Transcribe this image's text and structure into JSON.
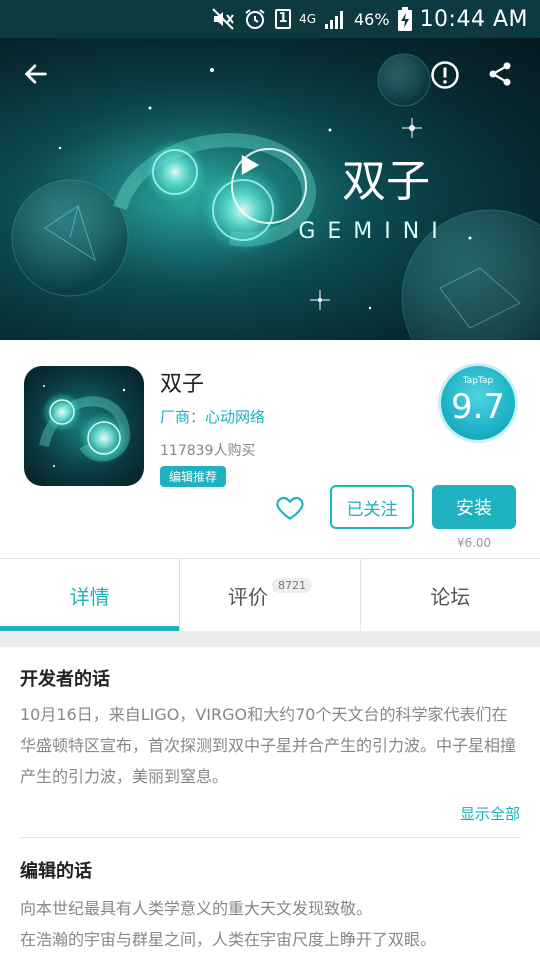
{
  "status_bar": {
    "sim_slot": "1",
    "network": "4G",
    "battery_percent": "46%",
    "time": "10:44 AM",
    "icons": [
      "mute-icon",
      "alarm-icon",
      "sim-icon",
      "signal-icon",
      "battery-charging-icon"
    ]
  },
  "hero": {
    "title_cn": "双子",
    "title_en": "GEMINI",
    "icons": [
      "back-arrow-icon",
      "report-icon",
      "share-icon",
      "play-icon"
    ]
  },
  "app": {
    "name": "双子",
    "developer": "厂商：心动网络",
    "purchases": "117839人购买",
    "badge": "编辑推荐",
    "rating_brand": "TapTap",
    "rating": "9.7",
    "follow_label": "已关注",
    "install_label": "安装",
    "price": "¥6.00"
  },
  "tabs": [
    {
      "label": "详情",
      "active": true
    },
    {
      "label": "评价",
      "count": "8721",
      "active": false
    },
    {
      "label": "论坛",
      "active": false
    }
  ],
  "developer_note": {
    "title": "开发者的话",
    "body": "10月16日，来自LIGO，VIRGO和大约70个天文台的科学家代表们在华盛顿特区宣布，首次探测到双中子星并合产生的引力波。中子星相撞产生的引力波，美丽到窒息。",
    "show_all": "显示全部"
  },
  "editor_note": {
    "title": "编辑的话",
    "line1": "向本世纪最具有人类学意义的重大天文发现致敬。",
    "line2": "在浩瀚的宇宙与群星之间，人类在宇宙尺度上睁开了双眼。"
  },
  "colors": {
    "accent": "#1eb1bf",
    "status_bar": "#0c3a40",
    "hero_dark": "#072a31"
  }
}
